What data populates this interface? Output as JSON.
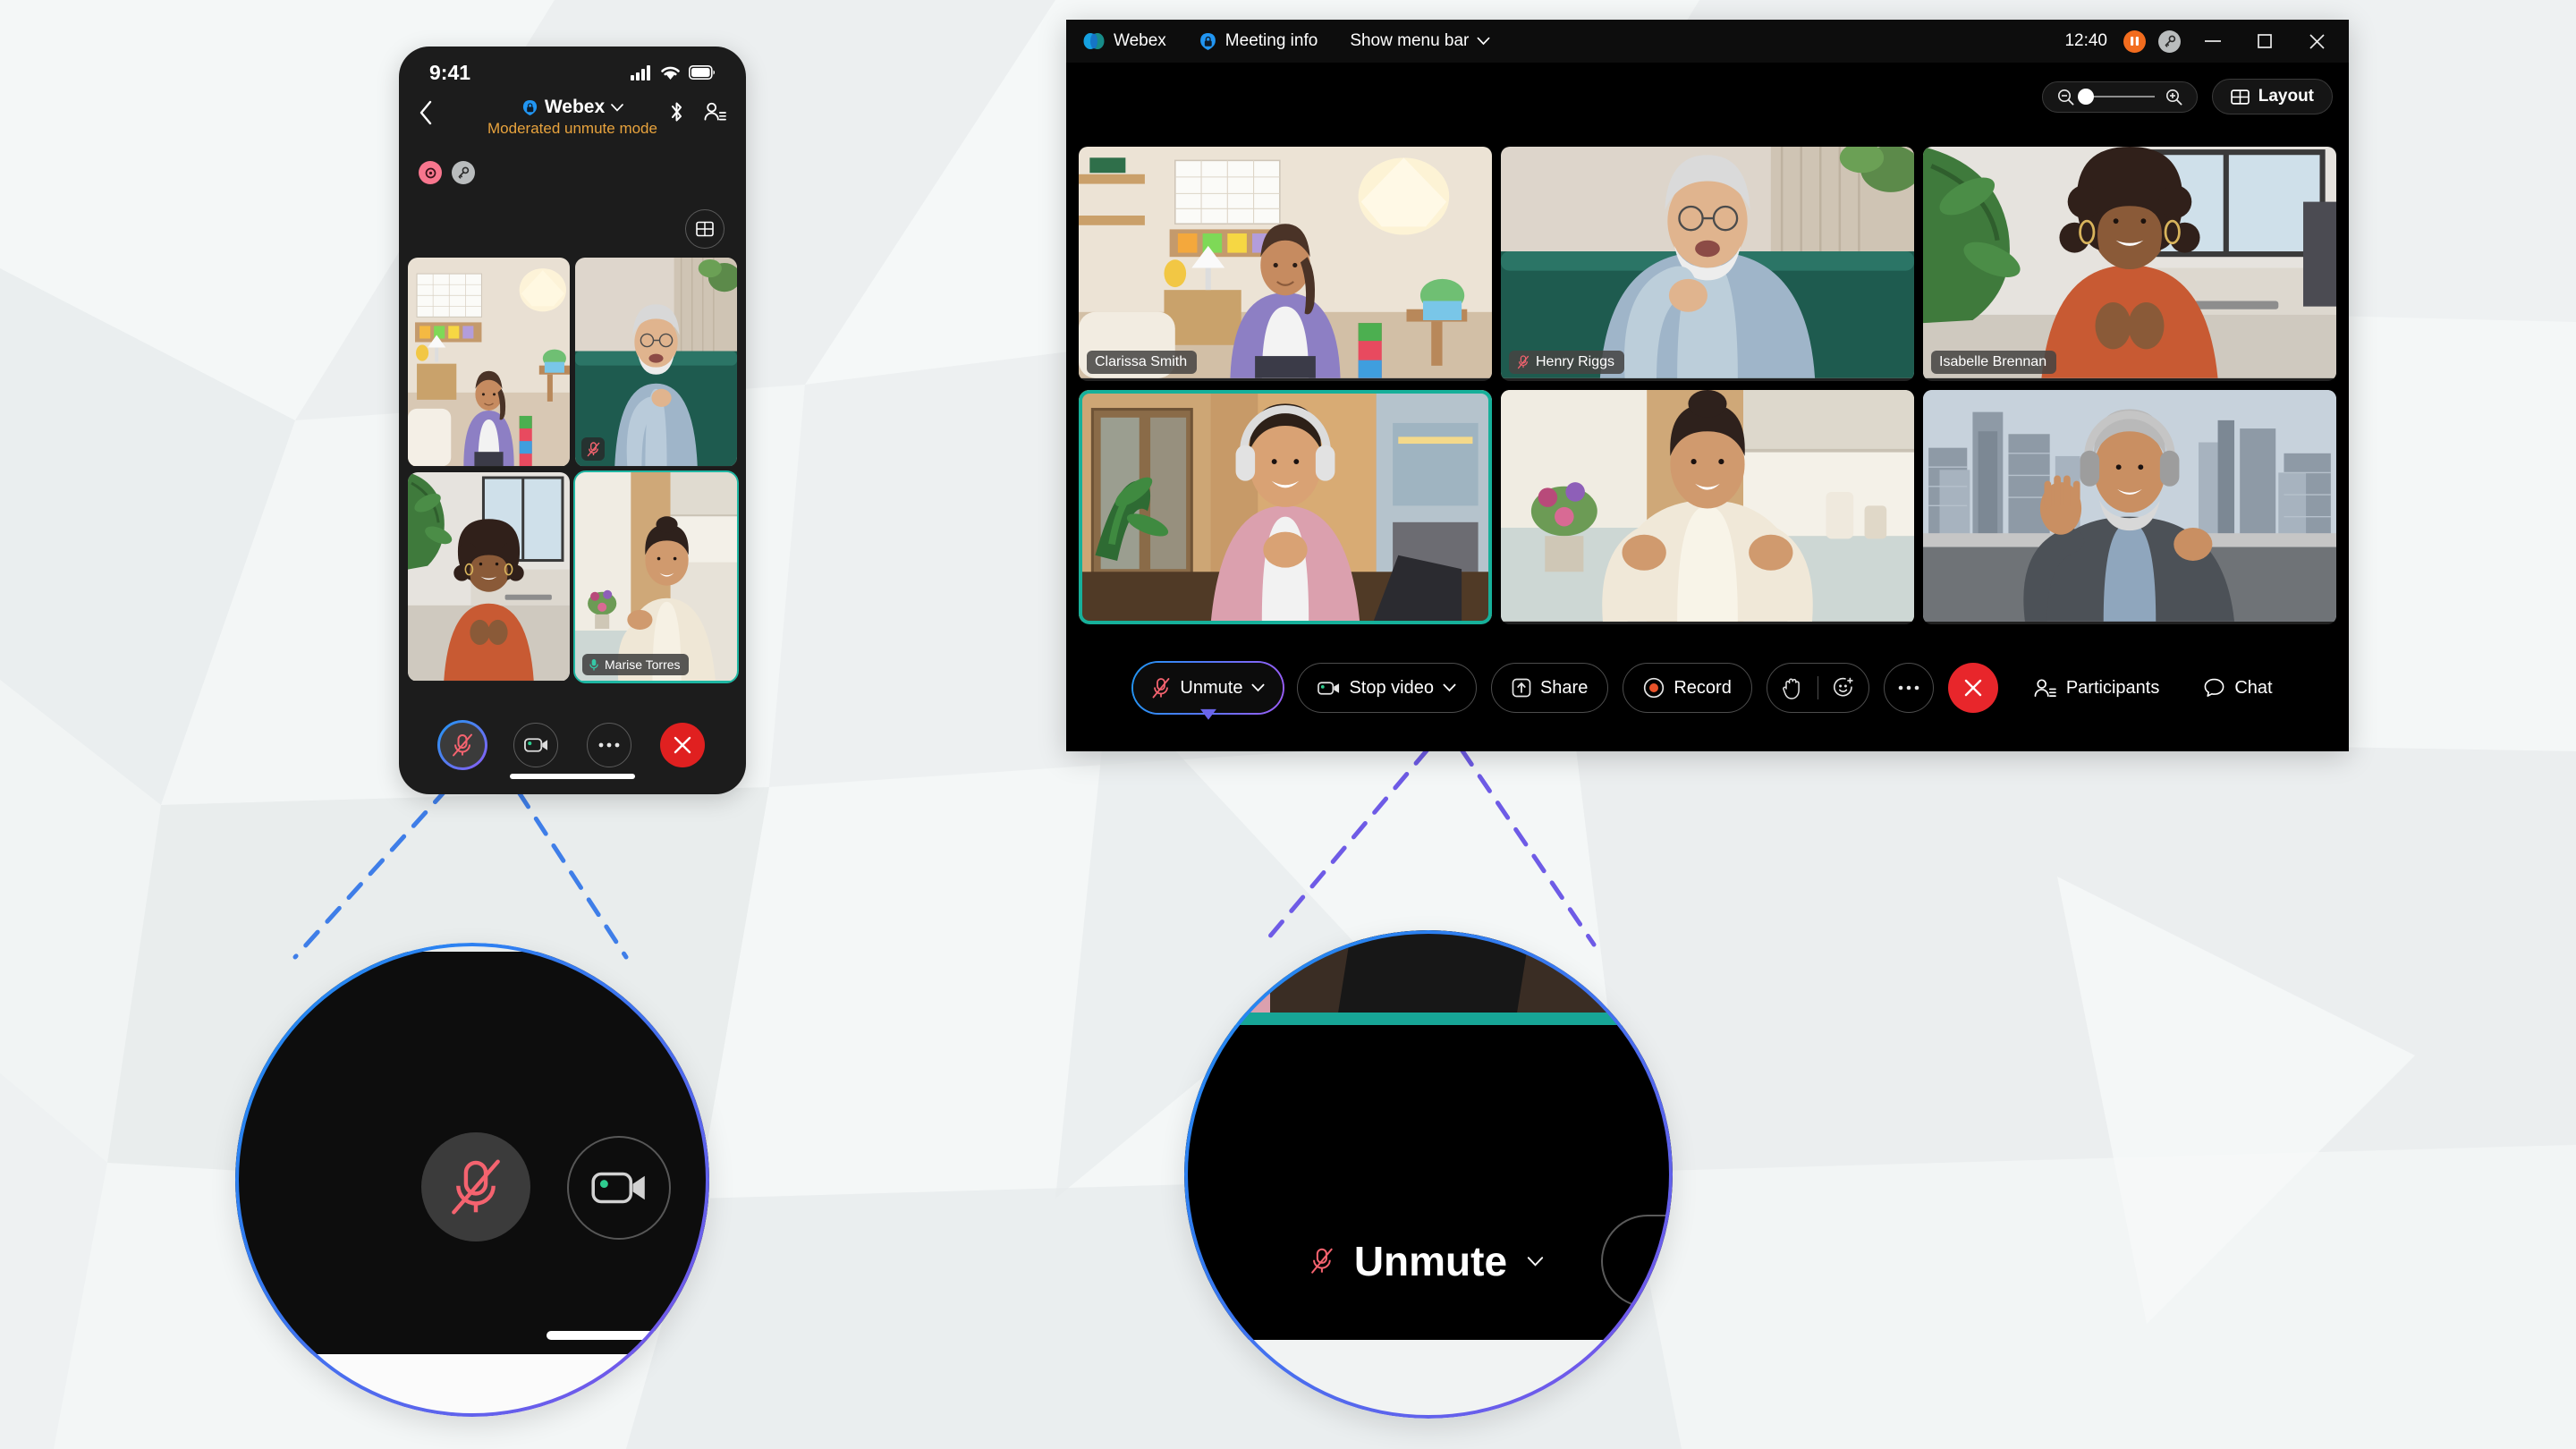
{
  "background": {
    "color": "#eef1f2"
  },
  "mobile": {
    "status": {
      "time": "9:41",
      "signal_icon": "cellular-signal-icon",
      "wifi_icon": "wifi-icon",
      "battery_icon": "battery-icon"
    },
    "header": {
      "back_icon": "back-chevron-icon",
      "app_name": "Webex",
      "app_lock_icon": "meeting-lock-icon",
      "dropdown_icon": "chevron-down-icon",
      "subtitle": "Moderated unmute mode",
      "bluetooth_icon": "bluetooth-icon",
      "participants_icon": "participants-icon"
    },
    "badges": [
      {
        "name": "recording-badge",
        "icon": "record-dot-icon",
        "color": "#f8768e"
      },
      {
        "name": "encryption-key-badge",
        "icon": "key-icon",
        "color": "#b9bcbd"
      }
    ],
    "layout_button": {
      "icon": "grid-layout-icon"
    },
    "tiles": [
      {
        "name": "Clarissa Smith",
        "muted": false,
        "active_speaker": false,
        "show_label": false
      },
      {
        "name": "Henry Riggs",
        "muted": true,
        "active_speaker": false,
        "show_label": false
      },
      {
        "name": "Isabelle Brennan",
        "muted": false,
        "active_speaker": false,
        "show_label": false
      },
      {
        "name": "Marise Torres",
        "muted": false,
        "active_speaker": true,
        "show_label": true
      }
    ],
    "controls": [
      {
        "name": "mic-muted-button",
        "icon": "microphone-muted-icon",
        "state": "muted",
        "highlighted": true
      },
      {
        "name": "video-button",
        "icon": "video-camera-icon",
        "state": "on"
      },
      {
        "name": "more-options-button",
        "icon": "ellipsis-icon"
      },
      {
        "name": "end-call-button",
        "icon": "close-x-icon"
      }
    ]
  },
  "desktop": {
    "titlebar": {
      "app_name": "Webex",
      "app_icon": "webex-logo-icon",
      "meeting_info_label": "Meeting info",
      "meeting_info_icon": "meeting-lock-icon",
      "menu_bar_label": "Show menu bar",
      "menu_bar_chevron": "chevron-down-icon",
      "time": "12:40",
      "pause_badge_icon": "pause-icon",
      "key_badge_icon": "key-icon",
      "minimize_icon": "minimize-icon",
      "maximize_icon": "maximize-icon",
      "close_icon": "close-x-icon"
    },
    "toolbar": {
      "zoom_out_icon": "zoom-out-icon",
      "zoom_in_icon": "zoom-in-icon",
      "zoom_value": 0,
      "layout_label": "Layout",
      "layout_icon": "grid-layout-icon"
    },
    "tiles": [
      {
        "name": "Clarissa Smith",
        "muted": false,
        "active_speaker": false,
        "show_label": true
      },
      {
        "name": "Henry Riggs",
        "muted": true,
        "active_speaker": false,
        "show_label": true
      },
      {
        "name": "Isabelle Brennan",
        "muted": false,
        "active_speaker": false,
        "show_label": true
      },
      {
        "name": "",
        "muted": false,
        "active_speaker": true,
        "show_label": false
      },
      {
        "name": "",
        "muted": false,
        "active_speaker": false,
        "show_label": false
      },
      {
        "name": "",
        "muted": false,
        "active_speaker": false,
        "show_label": false
      }
    ],
    "controls": {
      "unmute_label": "Unmute",
      "unmute_icon": "microphone-muted-icon",
      "unmute_chevron": "chevron-down-icon",
      "stop_video_label": "Stop video",
      "stop_video_icon": "video-camera-icon",
      "stop_video_chevron": "chevron-down-icon",
      "share_label": "Share",
      "share_icon": "share-screen-icon",
      "record_label": "Record",
      "record_icon": "record-dot-icon",
      "raise_hand_icon": "raise-hand-icon",
      "reactions_icon": "reactions-smiley-icon",
      "more_icon": "ellipsis-icon",
      "end_call_icon": "close-x-icon",
      "participants_label": "Participants",
      "participants_icon": "participants-icon",
      "chat_label": "Chat",
      "chat_icon": "chat-bubble-icon"
    }
  },
  "callouts": {
    "mobile_zoom": {
      "mic_icon": "microphone-muted-icon",
      "video_icon": "video-camera-icon"
    },
    "desktop_zoom": {
      "unmute_label": "Unmute",
      "unmute_icon": "microphone-muted-icon",
      "unmute_chevron": "chevron-down-icon"
    }
  },
  "colors": {
    "accent_gradient_start": "#1b8ef2",
    "accent_gradient_end": "#8250e8",
    "muted_red": "#f4636f",
    "active_speaker_teal": "#16b09a",
    "end_call_red": "#e8262b",
    "warning_amber": "#e8a33d",
    "record_orange": "#f26c1e"
  }
}
